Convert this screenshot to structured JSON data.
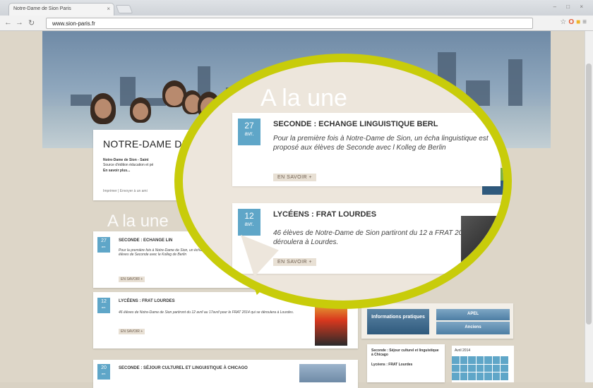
{
  "browser": {
    "tab_title": "Notre-Dame de Sion Paris",
    "url": "www.sion-paris.fr"
  },
  "page": {
    "school_title": "NOTRE-DAME DE",
    "intro_text": "Notre-Dame de Sion - Saint",
    "intro_text2": "Source d'édition éducation et pé",
    "read_more": "En savoir plus...",
    "bottom_links": "Imprimer | Envoyer à un ami",
    "a_la_une": "A la une",
    "news": [
      {
        "day": "27",
        "month": "avr.",
        "title": "SECONDE : ECHANGE LIN",
        "text": "Pour la première fois à Notre-Dame de Sion, un échange linguistique est proposé aux élèves de Seconde avec le Kolleg de Berlin",
        "more": "EN SAVOIR +"
      },
      {
        "day": "12",
        "month": "avr.",
        "title": "LYCÉENS : FRAT LOURDES",
        "text": "46 élèves de Notre-Dame de Sion partiront du 12 avril au 17avril pour le FRAT 2014 qui se déroulera à Lourdes.",
        "more": "EN SAVOIR +"
      },
      {
        "day": "20",
        "month": "avr.",
        "title": "SECONDE : SÉJOUR CULTUREL ET LINGUISTIQUE À CHICAGO",
        "text": "",
        "more": ""
      }
    ],
    "info_button": "Informations pratiques",
    "apel_button": "APEL",
    "anciens_button": "Anciens",
    "side_news": [
      "Seconde : Séjour culturel et linguistique à Chicago",
      "Lycéens : FRAT Lourdes"
    ],
    "calendar_label": "Avril 2014"
  },
  "lens": {
    "a_la_une": "A la une",
    "items": [
      {
        "day": "27",
        "month": "avr.",
        "title": "SECONDE : ECHANGE LINGUISTIQUE BERL",
        "text": "Pour la première fois à Notre-Dame de Sion, un écha linguistique est proposé aux élèves de Seconde avec l Kolleg de Berlin",
        "more": "EN SAVOIR +"
      },
      {
        "day": "12",
        "month": "avr.",
        "title": "LYCÉENS : FRAT LOURDES",
        "text": "46 élèves de Notre-Dame de Sion partiront du 12 a FRAT 2014 qui se déroulera à Lourdes.",
        "more": "EN SAVOIR +"
      }
    ]
  },
  "colors": {
    "accent": "#5fa6c8",
    "lens_border": "#c8cc0a",
    "button_blue": "#2f5a7d"
  },
  "icons": [
    "back-icon",
    "forward-icon",
    "reload-icon",
    "star-icon",
    "opera-icon",
    "folder-icon",
    "search-icon"
  ]
}
